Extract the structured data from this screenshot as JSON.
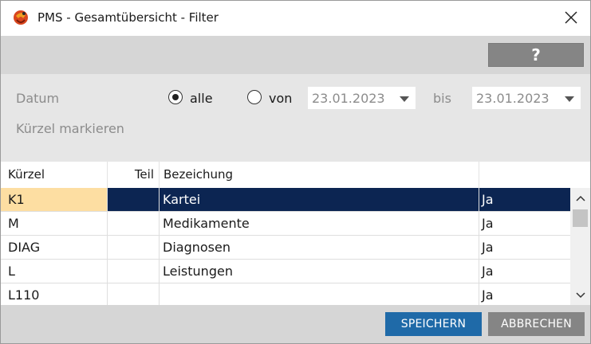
{
  "window": {
    "title": "PMS - Gesamtübersicht - Filter",
    "close_icon": "close-icon"
  },
  "toolbar": {
    "help_label": "?"
  },
  "filter": {
    "datum_label": "Datum",
    "radio_alle_label": "alle",
    "radio_von_label": "von",
    "selected_option": "alle",
    "date_from": "23.01.2023",
    "bis_label": "bis",
    "date_to": "23.01.2023",
    "kuerzel_label": "Kürzel markieren"
  },
  "table": {
    "columns": [
      "Kürzel",
      "Teil",
      "Bezeichung",
      ""
    ],
    "rows": [
      {
        "kuerzel": "K1",
        "teil": "",
        "bezeichnung": "Kartei",
        "value": "Ja",
        "selected": true
      },
      {
        "kuerzel": "M",
        "teil": "",
        "bezeichnung": "Medikamente",
        "value": "Ja",
        "selected": false
      },
      {
        "kuerzel": "DIAG",
        "teil": "",
        "bezeichnung": "Diagnosen",
        "value": "Ja",
        "selected": false
      },
      {
        "kuerzel": "L",
        "teil": "",
        "bezeichnung": "Leistungen",
        "value": "Ja",
        "selected": false
      },
      {
        "kuerzel": "L110",
        "teil": "",
        "bezeichnung": "",
        "value": "Ja",
        "selected": false
      }
    ]
  },
  "footer": {
    "save_label": "SPEICHERN",
    "cancel_label": "ABBRECHEN"
  },
  "colors": {
    "selection_bg": "#0c2552",
    "selection_key_bg": "#fddea2",
    "save_button": "#1f6aa8",
    "gray_button": "#858585"
  }
}
